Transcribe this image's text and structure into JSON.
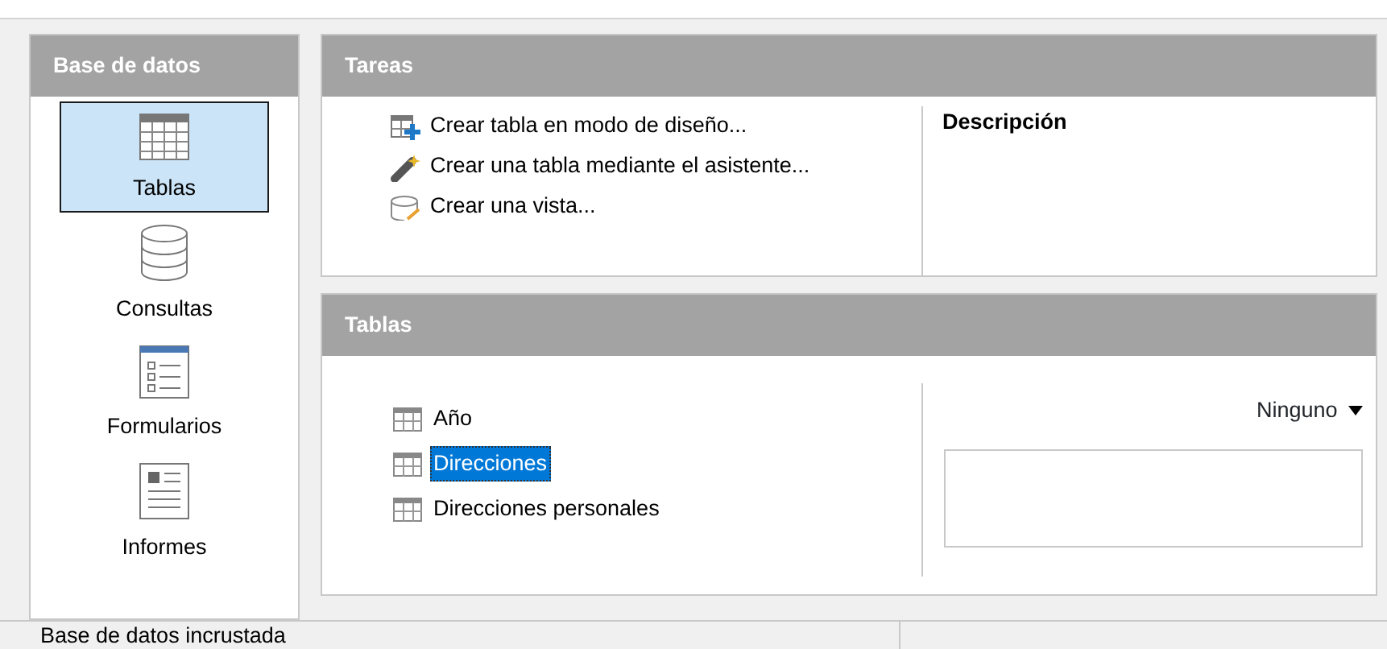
{
  "sidebar": {
    "title": "Base de datos",
    "items": [
      {
        "label": "Tablas",
        "kind": "tables",
        "selected": true
      },
      {
        "label": "Consultas",
        "kind": "queries",
        "selected": false
      },
      {
        "label": "Formularios",
        "kind": "forms",
        "selected": false
      },
      {
        "label": "Informes",
        "kind": "reports",
        "selected": false
      }
    ]
  },
  "tasks": {
    "title": "Tareas",
    "items": [
      {
        "label": "Crear tabla en modo de diseño...",
        "kind": "design"
      },
      {
        "label": "Crear una tabla mediante el asistente...",
        "kind": "wizard"
      },
      {
        "label": "Crear una vista...",
        "kind": "view"
      }
    ],
    "description_label": "Descripción"
  },
  "tables": {
    "title": "Tablas",
    "items": [
      {
        "label": "Año",
        "selected": false
      },
      {
        "label": "Direcciones",
        "selected": true
      },
      {
        "label": "Direcciones personales",
        "selected": false
      }
    ],
    "preview_dropdown": "Ninguno"
  },
  "status_bar": {
    "text": "Base de datos incrustada"
  }
}
